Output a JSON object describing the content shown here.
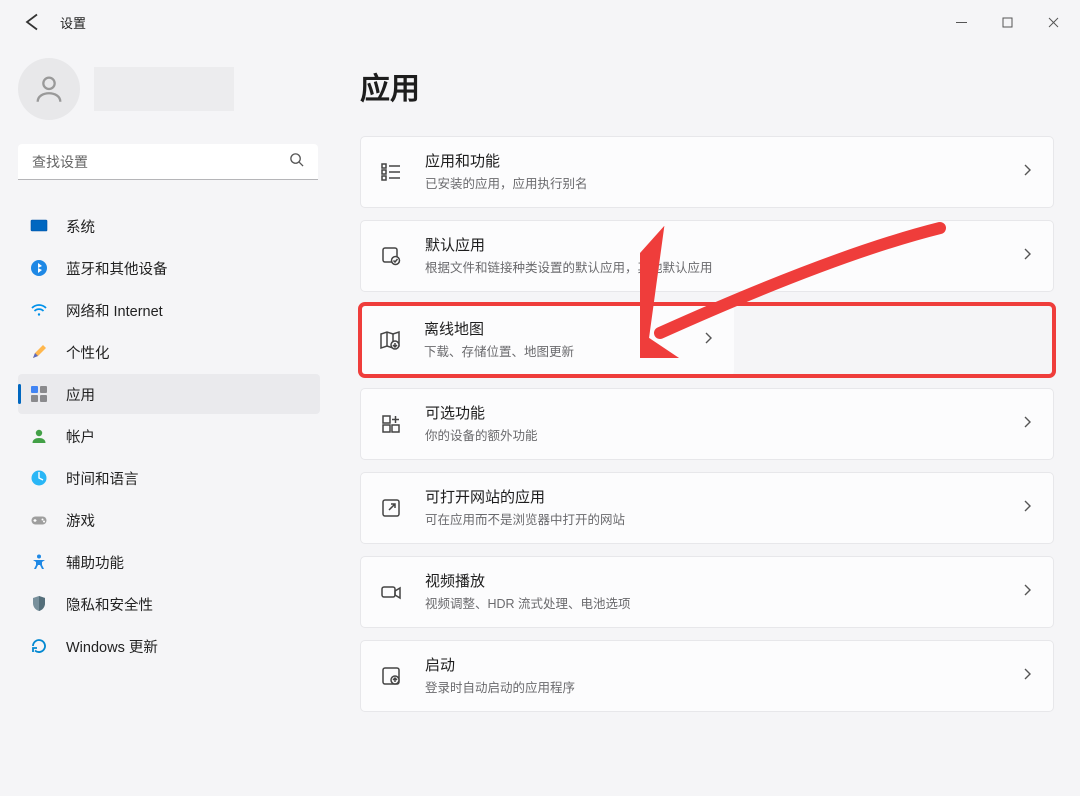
{
  "window": {
    "title": "设置"
  },
  "search": {
    "placeholder": "查找设置"
  },
  "nav": {
    "system": "系统",
    "bluetooth": "蓝牙和其他设备",
    "network": "网络和 Internet",
    "personalization": "个性化",
    "apps": "应用",
    "accounts": "帐户",
    "time": "时间和语言",
    "gaming": "游戏",
    "accessibility": "辅助功能",
    "privacy": "隐私和安全性",
    "update": "Windows 更新"
  },
  "page": {
    "title": "应用"
  },
  "cards": {
    "apps_features": {
      "title": "应用和功能",
      "sub": "已安装的应用，应用执行别名"
    },
    "default_apps": {
      "title": "默认应用",
      "sub": "根据文件和链接种类设置的默认应用，其他默认应用"
    },
    "offline_maps": {
      "title": "离线地图",
      "sub": "下载、存储位置、地图更新"
    },
    "optional": {
      "title": "可选功能",
      "sub": "你的设备的额外功能"
    },
    "pwa": {
      "title": "可打开网站的应用",
      "sub": "可在应用而不是浏览器中打开的网站"
    },
    "video": {
      "title": "视频播放",
      "sub": "视频调整、HDR 流式处理、电池选项"
    },
    "startup": {
      "title": "启动",
      "sub": "登录时自动启动的应用程序"
    }
  }
}
